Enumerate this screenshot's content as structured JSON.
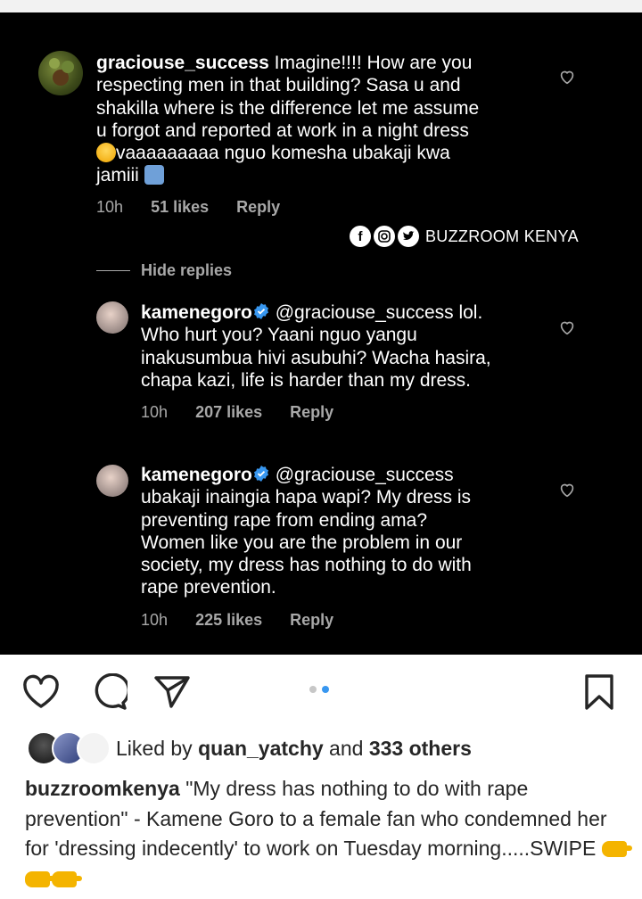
{
  "post": {
    "comments": [
      {
        "username": "graciouse_success",
        "text_lines": [
          " Imagine!!!! How are you",
          "respecting men in that building? Sasa u and",
          "shakilla where is the difference let me assume",
          "u forgot and reported at work in a night dress",
          "vaaaaaaaaa nguo komesha ubakaji kwa",
          "jamiii"
        ],
        "time": "10h",
        "likes": "51 likes",
        "reply": "Reply"
      }
    ],
    "hide_replies": "Hide replies",
    "replies": [
      {
        "username": "kamenegoro",
        "text_lines": [
          " @graciouse_success lol.",
          "Who hurt you? Yaani nguo yangu",
          "inakusumbua hivi asubuhi? Wacha hasira,",
          "chapa kazi, life is harder than my dress."
        ],
        "time": "10h",
        "likes": "207 likes",
        "reply": "Reply"
      },
      {
        "username": "kamenegoro",
        "text_lines": [
          " @graciouse_success",
          "ubakaji inaingia hapa wapi? My dress is",
          "preventing rape from ending ama?",
          "Women like you are the problem in our",
          "society, my dress has nothing to do with",
          "rape prevention."
        ],
        "time": "10h",
        "likes": "225 likes",
        "reply": "Reply"
      }
    ],
    "watermark": "BUZZROOM KENYA",
    "liked_prefix": "Liked by ",
    "liked_user": "quan_yatchy",
    "liked_mid": " and ",
    "liked_count": "333 others",
    "caption_user": "buzzroomkenya",
    "caption_text": " \"My dress has nothing to do with rape prevention\" - Kamene Goro to a female fan who condemned her for 'dressing indecently' to work on Tuesday morning.....SWIPE ",
    "colors": {
      "accent": "#3897f0",
      "dark_bg": "#000000",
      "meta_gray": "#a8a8a8"
    },
    "icons": [
      "heart-icon",
      "comment-icon",
      "share-icon",
      "bookmark-icon",
      "verified-badge-icon",
      "facebook-icon",
      "instagram-icon",
      "twitter-icon"
    ]
  }
}
